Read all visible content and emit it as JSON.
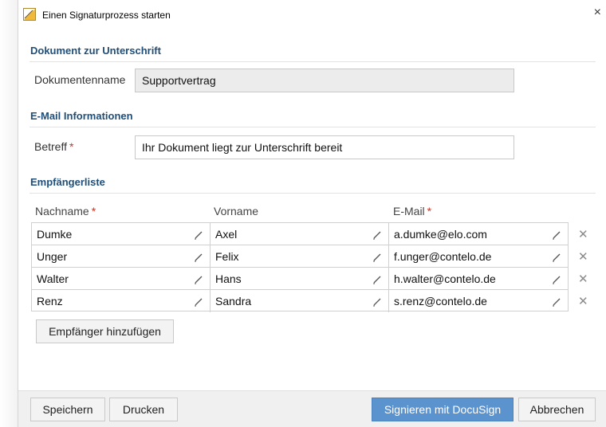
{
  "window": {
    "title": "Einen Signaturprozess starten",
    "close_glyph": "×"
  },
  "document_section": {
    "title": "Dokument zur Unterschrift",
    "name_label": "Dokumentenname",
    "name_value": "Supportvertrag"
  },
  "email_section": {
    "title": "E-Mail Informationen",
    "subject_label": "Betreff",
    "required_mark": "*",
    "subject_value": "Ihr Dokument liegt zur Unterschrift bereit"
  },
  "recipients": {
    "title": "Empfängerliste",
    "columns": {
      "lastname": "Nachname",
      "firstname": "Vorname",
      "email": "E-Mail"
    },
    "required_mark": "*",
    "rows": [
      {
        "lastname": "Dumke",
        "firstname": "Axel",
        "email": "a.dumke@elo.com"
      },
      {
        "lastname": "Unger",
        "firstname": "Felix",
        "email": "f.unger@contelo.de"
      },
      {
        "lastname": "Walter",
        "firstname": "Hans",
        "email": "h.walter@contelo.de"
      },
      {
        "lastname": "Renz",
        "firstname": "Sandra",
        "email": "s.renz@contelo.de"
      }
    ],
    "delete_glyph": "✕",
    "add_button": "Empfänger hinzufügen"
  },
  "footer": {
    "save": "Speichern",
    "print": "Drucken",
    "sign": "Signieren mit DocuSign",
    "cancel": "Abbrechen"
  },
  "colors": {
    "primary_button": "#5b93cf",
    "section_title": "#1f4e79",
    "required": "#c0392b"
  }
}
